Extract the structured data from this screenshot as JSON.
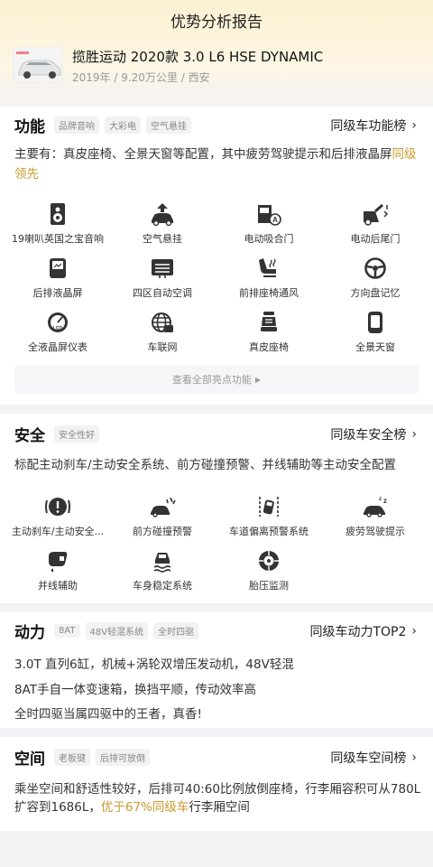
{
  "page": {
    "title": "优势分析报告"
  },
  "car": {
    "name": "揽胜运动 2020款 3.0 L6 HSE DYNAMIC",
    "meta": "2019年 / 9.20万公里 / 西安"
  },
  "features": {
    "title": "功能",
    "tags": [
      "品牌音响",
      "大彩电",
      "空气悬挂"
    ],
    "rank": "同级车功能榜",
    "desc_prefix": "主要有：真皮座椅、全景天窗等配置，其中疲劳驾驶提示和后排液晶屏",
    "desc_highlight": "同级领先",
    "items": [
      {
        "label": "19喇叭英国之宝音响",
        "icon": "speaker-icon"
      },
      {
        "label": "空气悬挂",
        "icon": "air-suspension-icon"
      },
      {
        "label": "电动吸合门",
        "icon": "soft-close-door-icon"
      },
      {
        "label": "电动后尾门",
        "icon": "power-tailgate-icon"
      },
      {
        "label": "后排液晶屏",
        "icon": "rear-screen-icon"
      },
      {
        "label": "四区自动空调",
        "icon": "climate-control-icon"
      },
      {
        "label": "前排座椅通风",
        "icon": "seat-ventilation-icon"
      },
      {
        "label": "方向盘记忆",
        "icon": "steering-memory-icon"
      },
      {
        "label": "全液晶屏仪表",
        "icon": "lcd-dashboard-icon"
      },
      {
        "label": "车联网",
        "icon": "connected-car-icon"
      },
      {
        "label": "真皮座椅",
        "icon": "leather-seat-icon"
      },
      {
        "label": "全景天窗",
        "icon": "panoramic-sunroof-icon"
      }
    ],
    "more": "查看全部亮点功能"
  },
  "safety": {
    "title": "安全",
    "tags": [
      "安全性好"
    ],
    "rank": "同级车安全榜",
    "desc": "标配主动刹车/主动安全系统、前方碰撞预警、并线辅助等主动安全配置",
    "items": [
      {
        "label": "主动刹车/主动安全...",
        "icon": "active-brake-icon"
      },
      {
        "label": "前方碰撞预警",
        "icon": "collision-warning-icon"
      },
      {
        "label": "车道偏离预警系统",
        "icon": "lane-departure-icon"
      },
      {
        "label": "疲劳驾驶提示",
        "icon": "fatigue-alert-icon"
      },
      {
        "label": "并线辅助",
        "icon": "blind-spot-icon"
      },
      {
        "label": "车身稳定系统",
        "icon": "stability-control-icon"
      },
      {
        "label": "胎压监测",
        "icon": "tire-pressure-icon"
      }
    ]
  },
  "power": {
    "title": "动力",
    "tags": [
      "8AT",
      "48V轻混系统",
      "全时四驱"
    ],
    "rank": "同级车动力TOP2",
    "lines": [
      "3.0T 直列6缸，机械+涡轮双增压发动机，48V轻混",
      "8AT手自一体变速箱，换挡平顺，传动效率高",
      "全时四驱当属四驱中的王者，真香!"
    ]
  },
  "space": {
    "title": "空间",
    "tags": [
      "老板键",
      "后排可放倒"
    ],
    "rank": "同级车空间榜",
    "desc_line1": "乘坐空间和舒适性较好，后排可40:60比例放倒座椅，行李厢容积可从780L",
    "desc_line2_prefix": "扩容到1686L，",
    "desc_line2_highlight": "优于67%同级车",
    "desc_line2_suffix": "行李厢空间"
  },
  "colors": {
    "accent": "#c99a2e",
    "icon": "#333333",
    "bg": "#f3f3f5"
  }
}
